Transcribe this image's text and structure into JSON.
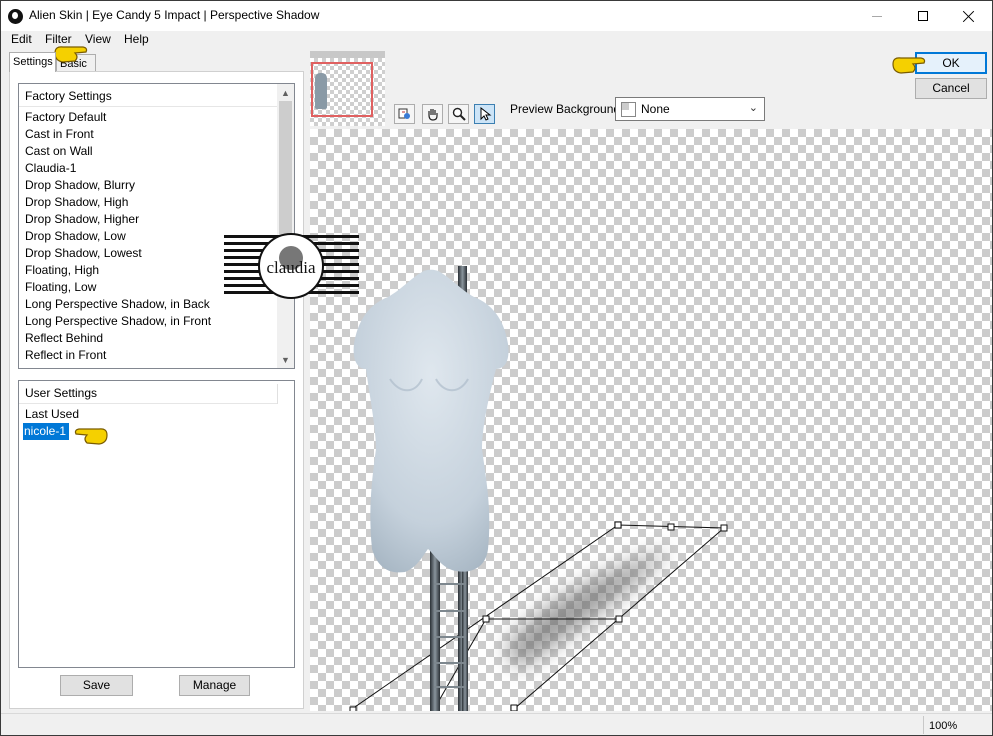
{
  "window": {
    "title": "Alien Skin | Eye Candy 5 Impact | Perspective Shadow"
  },
  "menu": {
    "items": [
      "Edit",
      "Filter",
      "View",
      "Help"
    ]
  },
  "tabs": {
    "settings": "Settings",
    "basic": "Basic"
  },
  "factory_settings": {
    "header": "Factory Settings",
    "items": [
      "Factory Default",
      "Cast in Front",
      "Cast on Wall",
      "Claudia-1",
      "Drop Shadow, Blurry",
      "Drop Shadow, High",
      "Drop Shadow, Higher",
      "Drop Shadow, Low",
      "Drop Shadow, Lowest",
      "Floating, High",
      "Floating, Low",
      "Long Perspective Shadow, in Back",
      "Long Perspective Shadow, in Front",
      "Reflect Behind",
      "Reflect in Front"
    ]
  },
  "user_settings": {
    "header": "User Settings",
    "items": [
      "Last Used",
      "nicole-1"
    ],
    "selected": "nicole-1"
  },
  "buttons": {
    "save": "Save",
    "manage": "Manage",
    "ok": "OK",
    "cancel": "Cancel"
  },
  "toolbar": {
    "preview_background_label": "Preview Background:",
    "preview_background_value": "None",
    "tools": [
      "navigate-preview-icon",
      "hand-pan-icon",
      "zoom-icon",
      "arrow-pointer-icon"
    ]
  },
  "watermark": {
    "text": "claudia"
  },
  "status": {
    "zoom": "100%"
  },
  "colors": {
    "accent": "#0078d7",
    "pointer_hand": "#f5d000",
    "figure": "#c9d5df"
  }
}
